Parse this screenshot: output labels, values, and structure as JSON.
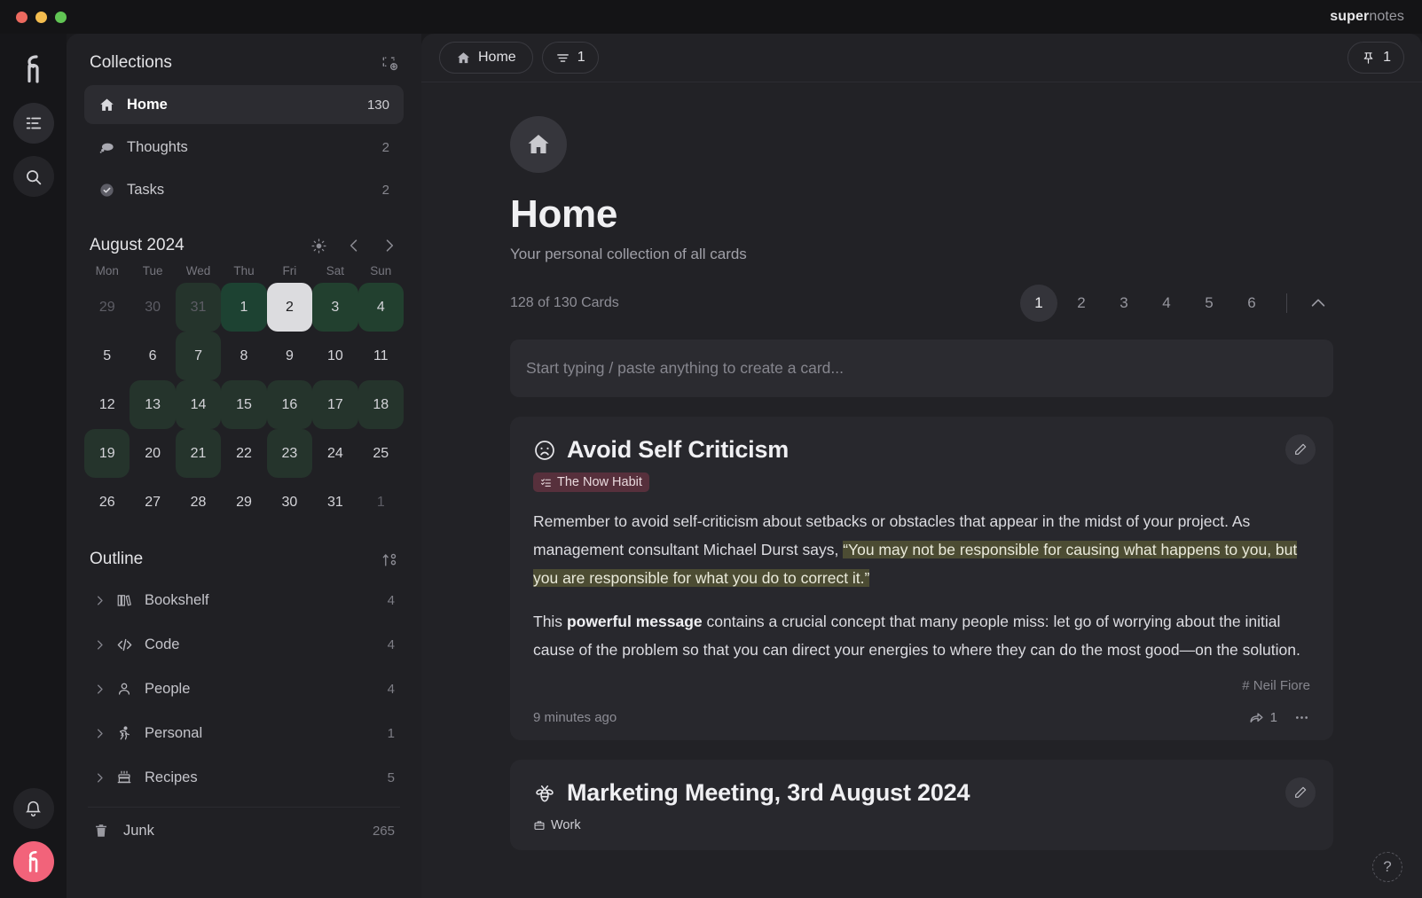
{
  "window": {
    "brand_bold": "super",
    "brand_light": "notes",
    "traffic": [
      "close",
      "minimize",
      "zoom"
    ]
  },
  "rail": {
    "logo": "supernotes-logo",
    "buttons": [
      {
        "name": "outline-view-button",
        "icon": "list-icon"
      },
      {
        "name": "search-button",
        "icon": "search-icon"
      }
    ],
    "notifications": {
      "name": "notifications-button",
      "icon": "bell-icon"
    },
    "avatar": {
      "name": "user-avatar",
      "icon": "supernotes-logo"
    }
  },
  "sidebar": {
    "collections_title": "Collections",
    "add_collection_label": "new-collection",
    "collections": [
      {
        "label": "Home",
        "count": "130",
        "icon": "home-icon",
        "selected": true
      },
      {
        "label": "Thoughts",
        "count": "2",
        "icon": "cloud-icon",
        "selected": false
      },
      {
        "label": "Tasks",
        "count": "2",
        "icon": "check-circle-icon",
        "selected": false
      }
    ],
    "calendar": {
      "title": "August 2024",
      "theme_toggle": "sun-icon",
      "prev": "chevron-left-icon",
      "next": "chevron-right-icon",
      "dow": [
        "Mon",
        "Tue",
        "Wed",
        "Thu",
        "Fri",
        "Sat",
        "Sun"
      ],
      "weeks": [
        [
          {
            "d": "29",
            "state": "muted",
            "heat": 0
          },
          {
            "d": "30",
            "state": "muted",
            "heat": 0
          },
          {
            "d": "31",
            "state": "muted",
            "heat": 1
          },
          {
            "d": "1",
            "state": "normal",
            "heat": 3
          },
          {
            "d": "2",
            "state": "today",
            "heat": 0
          },
          {
            "d": "3",
            "state": "normal",
            "heat": 2
          },
          {
            "d": "4",
            "state": "normal",
            "heat": 2
          }
        ],
        [
          {
            "d": "5",
            "state": "normal",
            "heat": 0
          },
          {
            "d": "6",
            "state": "normal",
            "heat": 0
          },
          {
            "d": "7",
            "state": "normal",
            "heat": 1
          },
          {
            "d": "8",
            "state": "normal",
            "heat": 0
          },
          {
            "d": "9",
            "state": "normal",
            "heat": 0
          },
          {
            "d": "10",
            "state": "normal",
            "heat": 0
          },
          {
            "d": "11",
            "state": "normal",
            "heat": 0
          }
        ],
        [
          {
            "d": "12",
            "state": "normal",
            "heat": 0
          },
          {
            "d": "13",
            "state": "normal",
            "heat": 1
          },
          {
            "d": "14",
            "state": "normal",
            "heat": 1
          },
          {
            "d": "15",
            "state": "normal",
            "heat": 1
          },
          {
            "d": "16",
            "state": "normal",
            "heat": 1
          },
          {
            "d": "17",
            "state": "normal",
            "heat": 1
          },
          {
            "d": "18",
            "state": "normal",
            "heat": 1
          }
        ],
        [
          {
            "d": "19",
            "state": "normal",
            "heat": 1
          },
          {
            "d": "20",
            "state": "normal",
            "heat": 0
          },
          {
            "d": "21",
            "state": "normal",
            "heat": 1
          },
          {
            "d": "22",
            "state": "normal",
            "heat": 0
          },
          {
            "d": "23",
            "state": "normal",
            "heat": 1
          },
          {
            "d": "24",
            "state": "normal",
            "heat": 0
          },
          {
            "d": "25",
            "state": "normal",
            "heat": 0
          }
        ],
        [
          {
            "d": "26",
            "state": "normal",
            "heat": 0
          },
          {
            "d": "27",
            "state": "normal",
            "heat": 0
          },
          {
            "d": "28",
            "state": "normal",
            "heat": 0
          },
          {
            "d": "29",
            "state": "normal",
            "heat": 0
          },
          {
            "d": "30",
            "state": "normal",
            "heat": 0
          },
          {
            "d": "31",
            "state": "normal",
            "heat": 0
          },
          {
            "d": "1",
            "state": "muted",
            "heat": 0
          }
        ]
      ]
    },
    "outline_title": "Outline",
    "outline_sort_label": "sort-outline",
    "outline": [
      {
        "label": "Bookshelf",
        "count": "4",
        "icon": "books-icon"
      },
      {
        "label": "Code",
        "count": "4",
        "icon": "code-icon"
      },
      {
        "label": "People",
        "count": "4",
        "icon": "person-icon"
      },
      {
        "label": "Personal",
        "count": "1",
        "icon": "runner-icon"
      },
      {
        "label": "Recipes",
        "count": "5",
        "icon": "cake-icon"
      }
    ],
    "junk": {
      "label": "Junk",
      "count": "265",
      "icon": "trash-icon"
    }
  },
  "main": {
    "breadcrumb": {
      "label": "Home",
      "icon": "home-icon"
    },
    "filter": {
      "count": "1",
      "icon": "filter-icon"
    },
    "pin": {
      "count": "1",
      "icon": "pin-icon"
    },
    "header": {
      "avatar_icon": "home-icon",
      "title": "Home",
      "subtitle": "Your personal collection of all cards",
      "card_count": "128 of 130 Cards"
    },
    "pagination": {
      "pages": [
        "1",
        "2",
        "3",
        "4",
        "5",
        "6"
      ],
      "active": "1",
      "collapse_icon": "chevron-up-icon"
    },
    "composer_placeholder": "Start typing / paste anything to create a card...",
    "cards": [
      {
        "emoji_icon": "frowning-face-icon",
        "title": "Avoid Self Criticism",
        "tag": {
          "label": "The Now Habit",
          "icon": "checklist-icon",
          "color": "#57303c"
        },
        "paragraphs": [
          {
            "segments": [
              {
                "text": "Remember to avoid self-criticism about setbacks or obstacles that appear in the midst of your project. As management consultant Michael Durst says, ",
                "style": "normal"
              },
              {
                "text": "“You may not be responsible for causing what happens to you, but you are responsible for what you do to correct it.”",
                "style": "highlight"
              }
            ]
          },
          {
            "segments": [
              {
                "text": "This ",
                "style": "normal"
              },
              {
                "text": "powerful message",
                "style": "bold"
              },
              {
                "text": " contains a crucial concept that many people miss: let go of worrying about the initial cause of the problem so that you can direct your energies to where they can do the most good—on the solution.",
                "style": "normal"
              }
            ]
          }
        ],
        "author": "# Neil Fiore",
        "timestamp": "9 minutes ago",
        "share_count": "1",
        "share_icon": "share-arrow-icon",
        "more_icon": "more-horizontal-icon",
        "edit_icon": "pencil-icon"
      },
      {
        "emoji_icon": "bee-icon",
        "title": "Marketing Meeting, 3rd August 2024",
        "tag": {
          "label": "Work",
          "icon": "briefcase-icon",
          "color": "transparent"
        },
        "paragraphs": [],
        "edit_icon": "pencil-icon"
      }
    ],
    "help": {
      "label": "?",
      "name": "help-button"
    }
  },
  "colors": {
    "accent_pink": "#f2637a",
    "highlight": "#4c4c33",
    "tag_maroon": "#57303c",
    "heat1": "#25342c",
    "heat2": "#22402f",
    "heat3": "#1d4232"
  }
}
